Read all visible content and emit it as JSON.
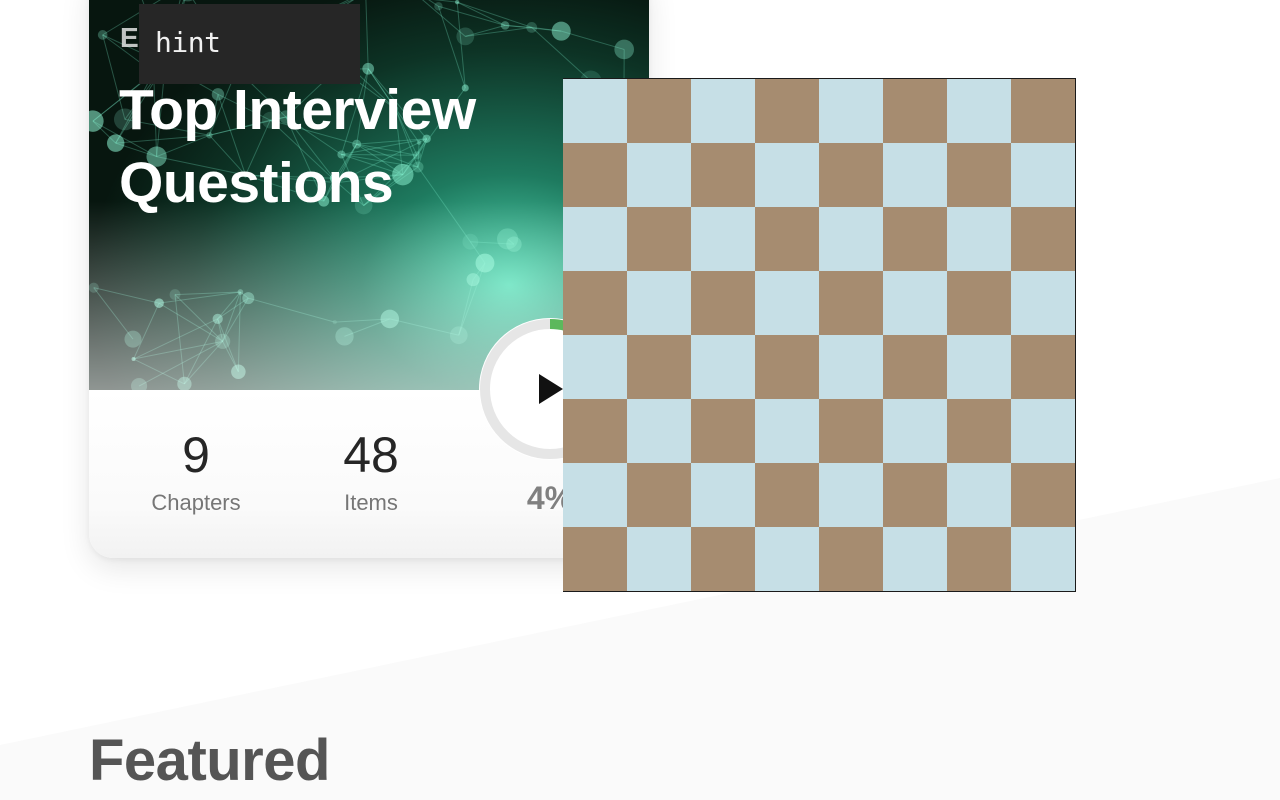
{
  "card": {
    "eyebrow": "E",
    "title_line1": "Top Interview",
    "title_line2": "Questions",
    "stats": [
      {
        "value": "9",
        "label": "Chapters"
      },
      {
        "value": "48",
        "label": "Items"
      }
    ],
    "progress": {
      "percent_text": "4%",
      "fraction": 0.04,
      "button": "play"
    }
  },
  "tooltip": {
    "text": "hint"
  },
  "chessboard": {
    "rows": 8,
    "cols": 8,
    "light_color": "#c6dfe6",
    "dark_color": "#a68c70"
  },
  "sections": {
    "featured_title": "Featured"
  },
  "colors": {
    "hero_dark": "#0c2119",
    "hero_accent": "#3fd6a8",
    "progress_track": "#e6e6e6",
    "progress_fill": "#5cb85c",
    "tooltip_bg": "#262626"
  },
  "icons": {
    "play": "play-icon"
  }
}
